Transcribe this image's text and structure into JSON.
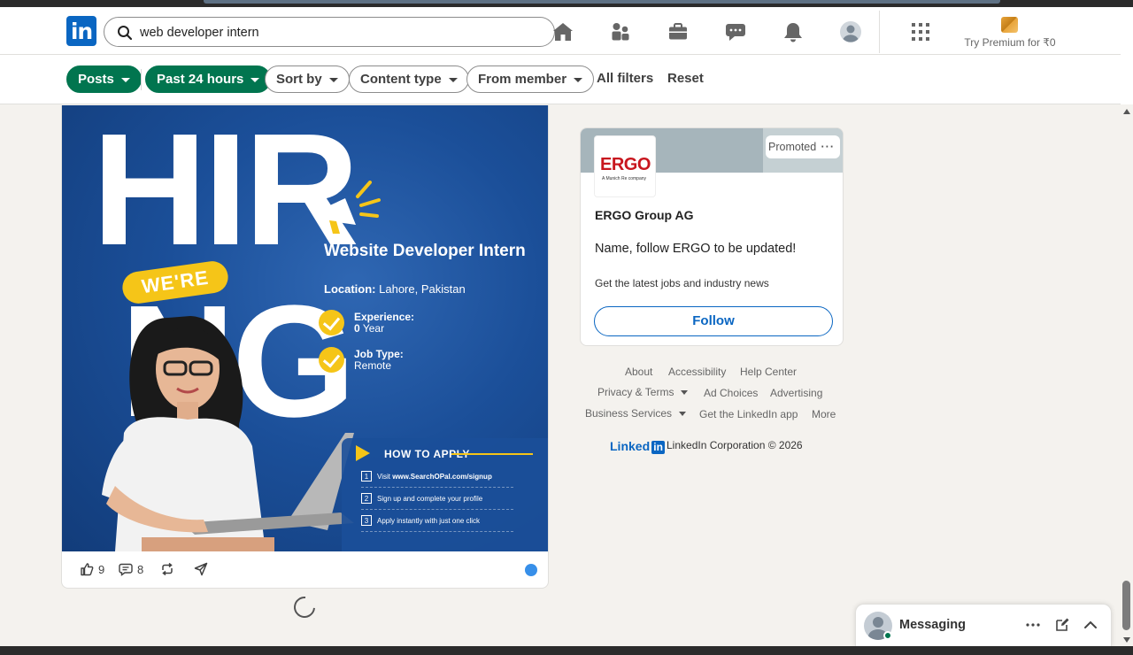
{
  "header": {
    "logo_text": "in",
    "search_value": "web developer intern",
    "search_placeholder": "Search",
    "premium_label": "Try Premium for ₹0"
  },
  "filters": {
    "posts": "Posts",
    "date": "Past 24 hours",
    "sort": "Sort by",
    "content_type": "Content type",
    "from_member": "From member",
    "all_filters": "All filters",
    "reset": "Reset"
  },
  "post": {
    "poster": {
      "big_word_top": "HIR",
      "big_word_bottom": "NG",
      "badge": "WE'RE",
      "title": "Website Developer Intern",
      "location_label": "Location:",
      "location_value": "Lahore, Pakistan",
      "experience_label": "Experience:",
      "experience_value_num": "0",
      "experience_value_unit": "Year",
      "jobtype_label": "Job Type:",
      "jobtype_value": "Remote",
      "how_to_apply": "HOW TO APPLY",
      "steps": [
        {
          "num": "1",
          "text_prefix": "Visit ",
          "text_bold": "www.SearchOPal.com/signup"
        },
        {
          "num": "2",
          "text": "Sign up and complete your profile"
        },
        {
          "num": "3",
          "text": "Apply instantly with just one click"
        }
      ]
    },
    "likes": "9",
    "comments": "8"
  },
  "ad": {
    "promoted": "Promoted",
    "logo_word": "ERGO",
    "logo_sub": "A Munich Re company",
    "company": "ERGO Group AG",
    "headline": "Name, follow ERGO to be updated!",
    "subtext": "Get the latest jobs and industry news",
    "follow": "Follow"
  },
  "footer": {
    "about": "About",
    "accessibility": "Accessibility",
    "help_center": "Help Center",
    "privacy_terms": "Privacy & Terms",
    "ad_choices": "Ad Choices",
    "advertising": "Advertising",
    "business_services": "Business Services",
    "get_app": "Get the LinkedIn app",
    "more": "More",
    "brand_word": "Linked",
    "brand_in": "in",
    "copyright": "LinkedIn Corporation © 2026"
  },
  "messaging": {
    "title": "Messaging"
  },
  "colors": {
    "brand_blue": "#0a66c2",
    "filter_green": "#01754f",
    "poster_yellow": "#f5c518",
    "ergo_red": "#c8161e"
  }
}
